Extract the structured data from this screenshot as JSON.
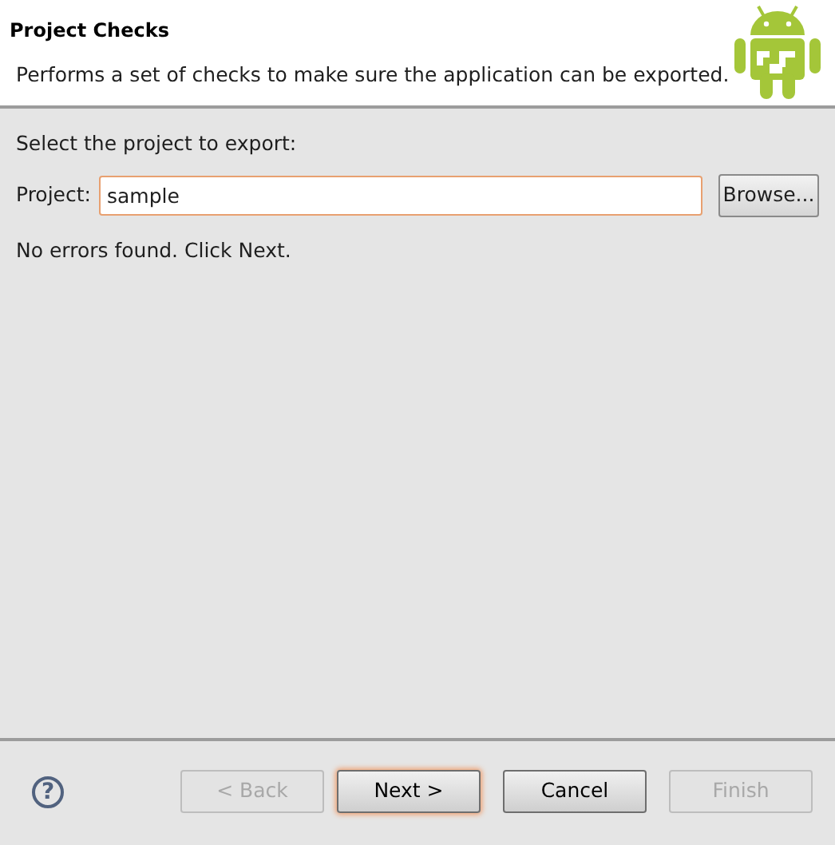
{
  "header": {
    "title": "Project Checks",
    "description": "Performs a set of checks to make sure the application can be exported."
  },
  "body": {
    "prompt": "Select the project to export:",
    "project_label": "Project:",
    "project_value": "sample",
    "project_focused": true,
    "browse_label": "Browse...",
    "status": "No errors found. Click Next."
  },
  "footer": {
    "help": "?",
    "buttons": [
      {
        "label": "< Back",
        "disabled": true,
        "default": false
      },
      {
        "label": "Next >",
        "disabled": false,
        "default": true
      },
      {
        "label": "Cancel",
        "disabled": false,
        "default": false
      },
      {
        "label": "Finish",
        "disabled": true,
        "default": false
      }
    ]
  }
}
